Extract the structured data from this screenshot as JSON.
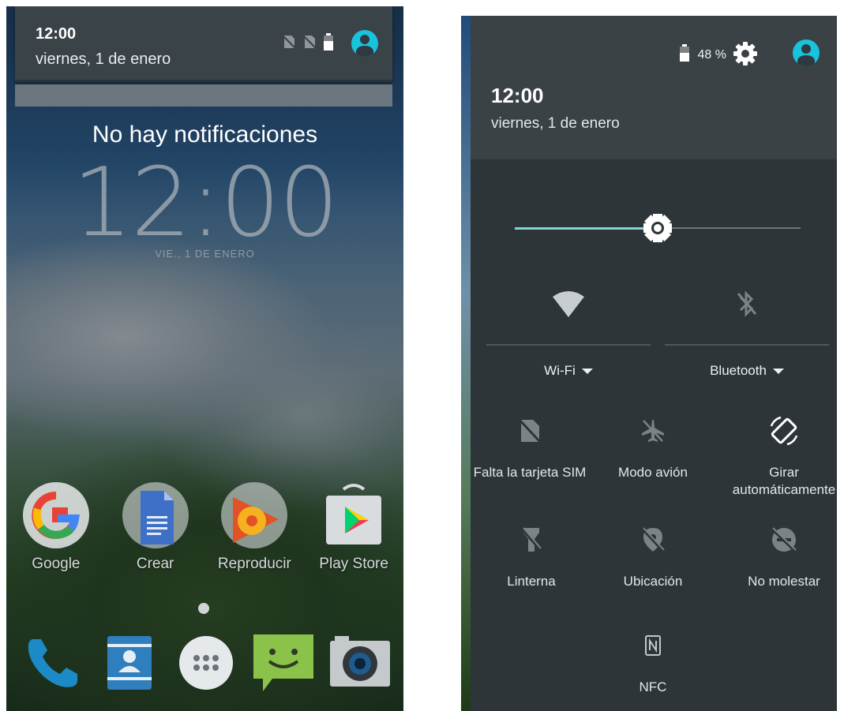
{
  "left_screen": {
    "shade": {
      "time": "12:00",
      "date": "viernes, 1 de enero"
    },
    "lockscreen": {
      "no_notifications": "No hay notificaciones",
      "clock": "12:00",
      "date": "VIE., 1 DE ENERO"
    },
    "apps": [
      {
        "label": "Google",
        "icon": "google-icon"
      },
      {
        "label": "Crear",
        "icon": "docs-icon"
      },
      {
        "label": "Reproducir",
        "icon": "play-music-icon"
      },
      {
        "label": "Play Store",
        "icon": "play-store-icon"
      }
    ],
    "dock": [
      {
        "icon": "phone-icon"
      },
      {
        "icon": "contacts-icon"
      },
      {
        "icon": "app-drawer-icon"
      },
      {
        "icon": "messaging-icon"
      },
      {
        "icon": "camera-icon"
      }
    ]
  },
  "right_screen": {
    "header": {
      "battery_percent": "48 %",
      "time": "12:00",
      "date": "viernes, 1 de enero"
    },
    "brightness_level": 0.49,
    "big_tiles": [
      {
        "label": "Wi-Fi",
        "icon": "wifi-icon"
      },
      {
        "label": "Bluetooth",
        "icon": "bluetooth-off-icon"
      }
    ],
    "tiles": [
      {
        "label": "Falta la tarjeta SIM",
        "icon": "no-sim-icon"
      },
      {
        "label": "Modo avión",
        "icon": "airplane-icon"
      },
      {
        "label": "Girar automáticamente",
        "icon": "auto-rotate-icon"
      },
      {
        "label": "Linterna",
        "icon": "flashlight-icon"
      },
      {
        "label": "Ubicación",
        "icon": "location-off-icon"
      },
      {
        "label": "No molestar",
        "icon": "do-not-disturb-icon"
      },
      {
        "label": "NFC",
        "icon": "nfc-icon"
      }
    ]
  },
  "colors": {
    "accent": "#19c2dd",
    "panel": "#2d3539",
    "header": "#3a4246",
    "slider": "#7fd6d2"
  }
}
